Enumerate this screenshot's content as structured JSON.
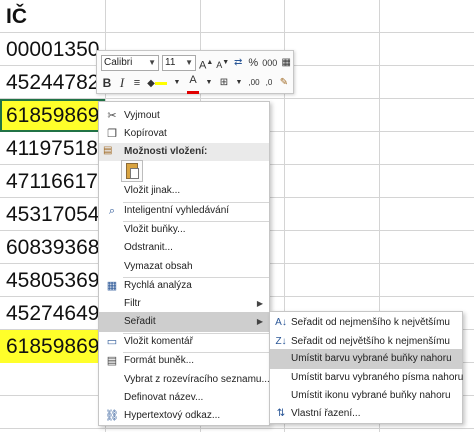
{
  "sheet": {
    "header": "IČ",
    "cells": [
      {
        "value": "00001350",
        "highlight": false
      },
      {
        "value": "45244782",
        "highlight": false
      },
      {
        "value": "61859869",
        "highlight": true
      },
      {
        "value": "41197518",
        "highlight": false
      },
      {
        "value": "47116617",
        "highlight": false
      },
      {
        "value": "45317054",
        "highlight": false
      },
      {
        "value": "60839368",
        "highlight": false
      },
      {
        "value": "45805369",
        "highlight": false
      },
      {
        "value": "45274649",
        "highlight": false
      },
      {
        "value": "61859869",
        "highlight": true
      }
    ],
    "highlight_color": "#ffff2a"
  },
  "mini_toolbar": {
    "font_name": "Calibri",
    "font_size": "11",
    "grow_font": "A",
    "shrink_font": "A",
    "percent": "%",
    "thousands": "000",
    "bold": "B",
    "italic": "I",
    "font_color_letter": "A",
    "fill_color": "#ffff00",
    "font_color": "#e00000"
  },
  "context_menu": {
    "cut": "Vyjmout",
    "copy": "Kopírovat",
    "paste_options_header": "Možnosti vložení:",
    "paste_special": "Vložit jinak...",
    "smart_lookup": "Inteligentní vyhledávání",
    "insert_cells": "Vložit buňky...",
    "delete": "Odstranit...",
    "clear_contents": "Vymazat obsah",
    "quick_analysis": "Rychlá analýza",
    "filter": "Filtr",
    "sort": "Seřadit",
    "insert_comment": "Vložit komentář",
    "format_cells": "Formát buněk...",
    "pick_from_list": "Vybrat z rozevíracího seznamu...",
    "define_name": "Definovat název...",
    "hyperlink": "Hypertextový odkaz..."
  },
  "sort_submenu": {
    "ascending": "Seřadit od nejmenšího k největšímu",
    "descending": "Seřadit od největšího k nejmenšímu",
    "cell_color_top": "Umístit barvu vybrané buňky nahoru",
    "font_color_top": "Umístit barvu vybraného písma nahoru",
    "icon_top": "Umístit ikonu vybrané buňky nahoru",
    "custom_sort": "Vlastní řazení..."
  }
}
